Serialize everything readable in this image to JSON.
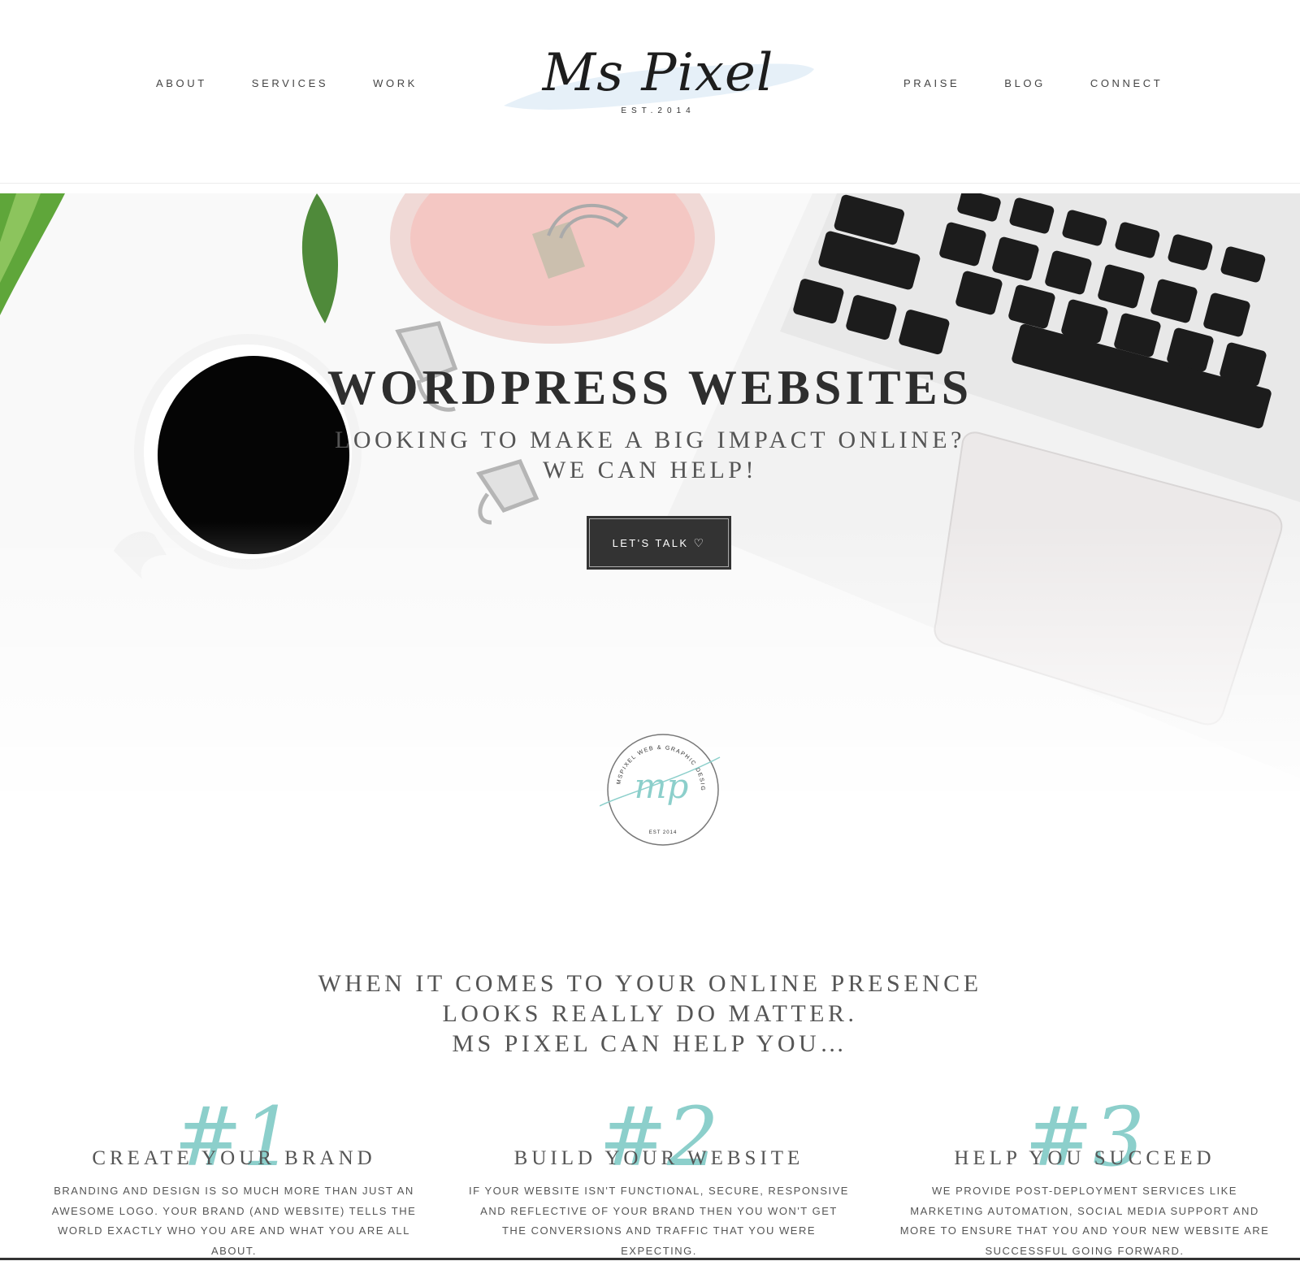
{
  "header": {
    "nav_left": [
      "About",
      "Services",
      "Work"
    ],
    "nav_right": [
      "Praise",
      "Blog",
      "Connect"
    ],
    "logo": {
      "script": "Ms Pixel",
      "est": "EST.2014"
    }
  },
  "hero": {
    "title": "WORDPRESS WEBSITES",
    "subtitle_line1": "LOOKING TO MAKE A BIG IMPACT ONLINE?",
    "subtitle_line2": "WE CAN HELP!",
    "cta_label": "LET'S TALK",
    "cta_icon": "heart-outline-icon"
  },
  "badge": {
    "ring_text": "MSPIXEL WEB & GRAPHIC DESIGN",
    "monogram": "mp",
    "est": "EST 2014"
  },
  "intro": {
    "line1": "WHEN IT COMES TO YOUR ONLINE PRESENCE",
    "line2": "LOOKS REALLY DO MATTER.",
    "line3": "MS PIXEL CAN HELP YOU…"
  },
  "services": [
    {
      "num": "#1",
      "title": "CREATE YOUR BRAND",
      "text": "Branding and design is so much more than just an awesome logo. Your brand (and website) tells the world exactly who you are and what you are all about."
    },
    {
      "num": "#2",
      "title": "BUILD YOUR WEBSITE",
      "text": "If your website isn't functional, secure, responsive and reflective of your brand then you won't get the conversions and traffic that you were expecting."
    },
    {
      "num": "#3",
      "title": "HELP YOU SUCCEED",
      "text": "We provide post-deployment services like marketing automation, social media support and more to ensure that you and your new website are successful going forward."
    }
  ],
  "colors": {
    "accent_teal": "#8ccfcb",
    "dark": "#333333",
    "pink": "#f4c7c3"
  }
}
